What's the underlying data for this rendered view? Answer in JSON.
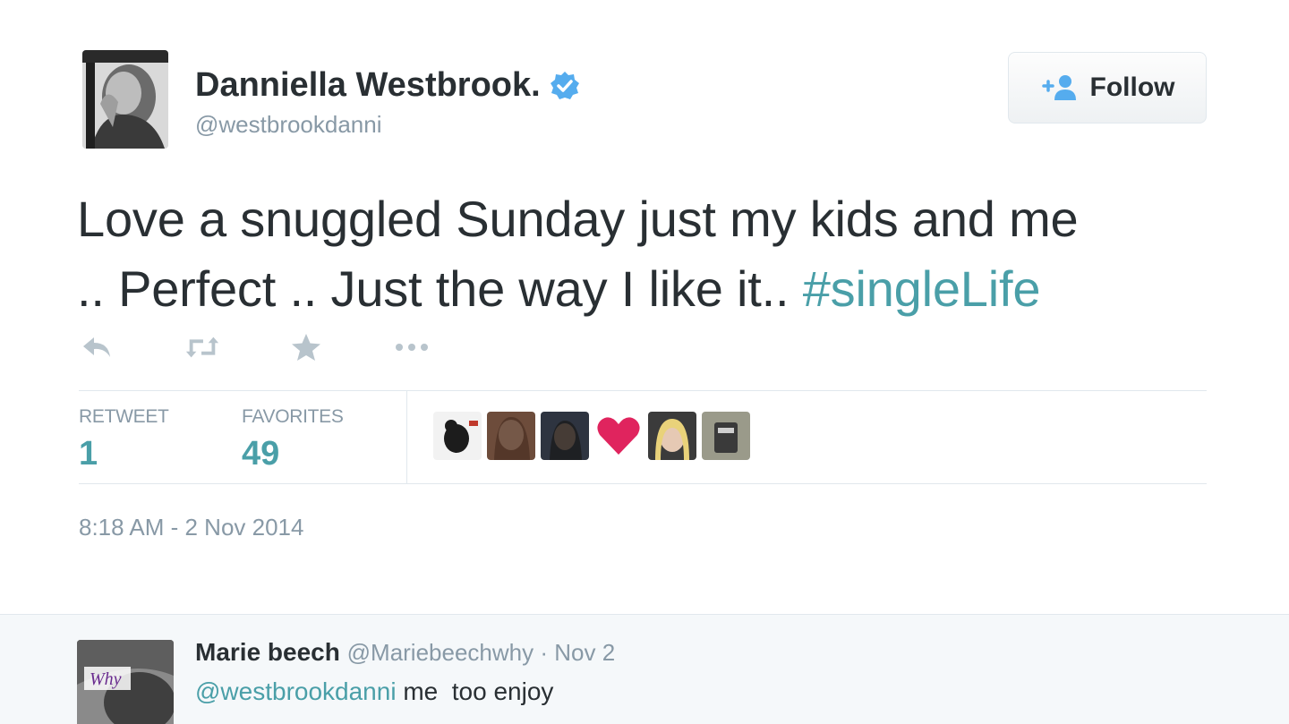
{
  "tweet": {
    "author_name": "Danniella Westbrook.",
    "handle": "@westbrookdanni",
    "follow_label": "Follow",
    "text_line1": "Love a snuggled Sunday just my kids and me",
    "text_line2_plain": ".. Perfect .. Just the way I like it.. ",
    "hashtag": "#singleLife",
    "actions": [
      "reply-icon",
      "retweet-icon",
      "favorite-icon",
      "more-icon"
    ],
    "stats": {
      "retweet_label": "RETWEET",
      "retweet_count": "1",
      "favorites_label": "FAVORITES",
      "favorites_count": "49"
    },
    "favorited_by_count_shown": 6,
    "timestamp": "8:18 AM - 2 Nov 2014"
  },
  "reply": {
    "name": "Marie beech",
    "handle": "@Mariebeechwhy",
    "separator": " · ",
    "date": "Nov 2",
    "mention": "@westbrookdanni",
    "text": " me  too enjoy",
    "avatar_text": "Why"
  },
  "colors": {
    "link": "#4a9fa8",
    "muted": "#8899a6",
    "text": "#292f33",
    "verified": "#55acee",
    "heart": "#e0245e"
  }
}
